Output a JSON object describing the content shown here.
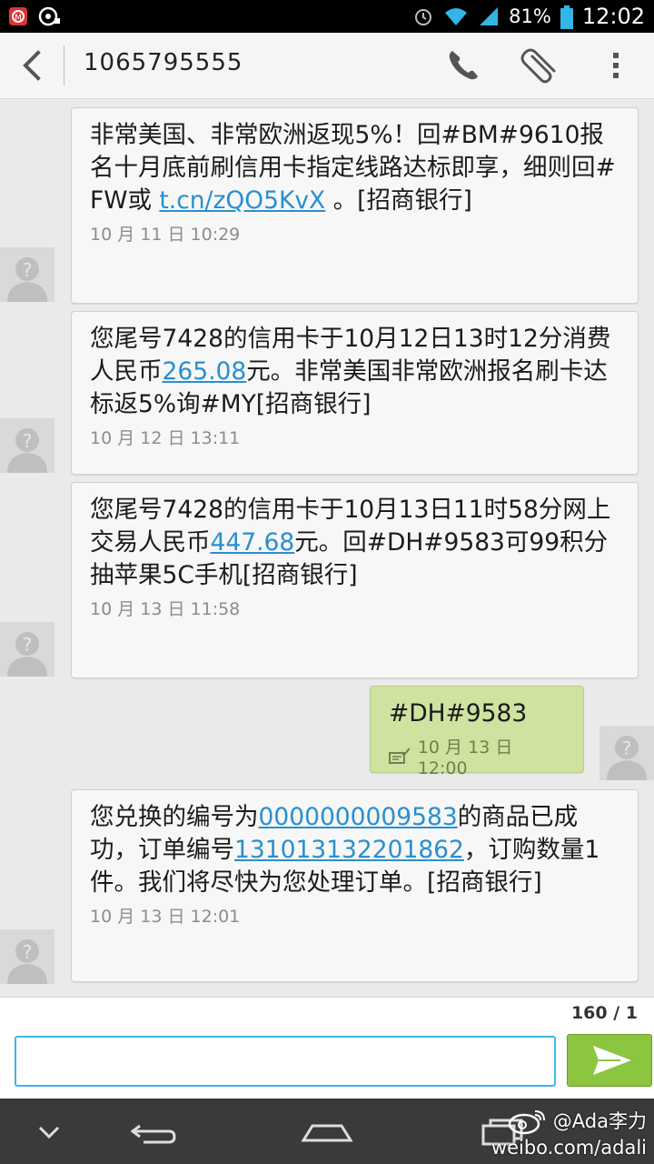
{
  "status_bar": {
    "battery_percent": "81%",
    "time": "12:02"
  },
  "action_bar": {
    "contact": "1065795555",
    "icons": [
      "back-icon",
      "phone-icon",
      "paperclip-icon",
      "overflow-menu-icon"
    ]
  },
  "messages": [
    {
      "direction": "received",
      "body_pre": "非常美国、非常欧洲返现5%！回#BM#9610报名十月底前刷信用卡指定线路达标即享，细则回#FW或 ",
      "link1": "t.cn/zQO5KvX",
      "body_mid": " 。[招商银行]",
      "link2": "",
      "body_post": "",
      "timestamp": "10 月 11 日 10:29"
    },
    {
      "direction": "received",
      "body_pre": "您尾号7428的信用卡于10月12日13时12分消费人民币",
      "link1": "265.08",
      "body_mid": "元。非常美国非常欧洲报名刷卡达标返5%询#MY[招商银行]",
      "link2": "",
      "body_post": "",
      "timestamp": "10 月 12 日 13:11"
    },
    {
      "direction": "received",
      "body_pre": "您尾号7428的信用卡于10月13日11时58分网上交易人民币",
      "link1": "447.68",
      "body_mid": "元。回#DH#9583可99积分抽苹果5C手机[招商银行]",
      "link2": "",
      "body_post": "",
      "timestamp": "10 月 13 日 11:58"
    },
    {
      "direction": "sent",
      "body_pre": "#DH#9583",
      "link1": "",
      "body_mid": "",
      "link2": "",
      "body_post": "",
      "timestamp": "10 月 13 日 12:00"
    },
    {
      "direction": "received",
      "body_pre": "您兑换的编号为",
      "link1": "0000000009583",
      "body_mid": "的商品已成功，订单编号",
      "link2": "131013132201862",
      "body_post": "，订购数量1件。我们将尽快为您处理订单。[招商银行]",
      "timestamp": "10 月 13 日 12:01"
    }
  ],
  "compose": {
    "char_count": "160 / 1",
    "input_value": "",
    "input_placeholder": ""
  },
  "watermark": {
    "handle": "@Ada李力",
    "url": "weibo.com/adali"
  },
  "colors": {
    "link": "#2a8fcf",
    "sent_bubble": "#cfe3a1",
    "send_button": "#8cc53f",
    "input_border": "#41b6e6"
  }
}
